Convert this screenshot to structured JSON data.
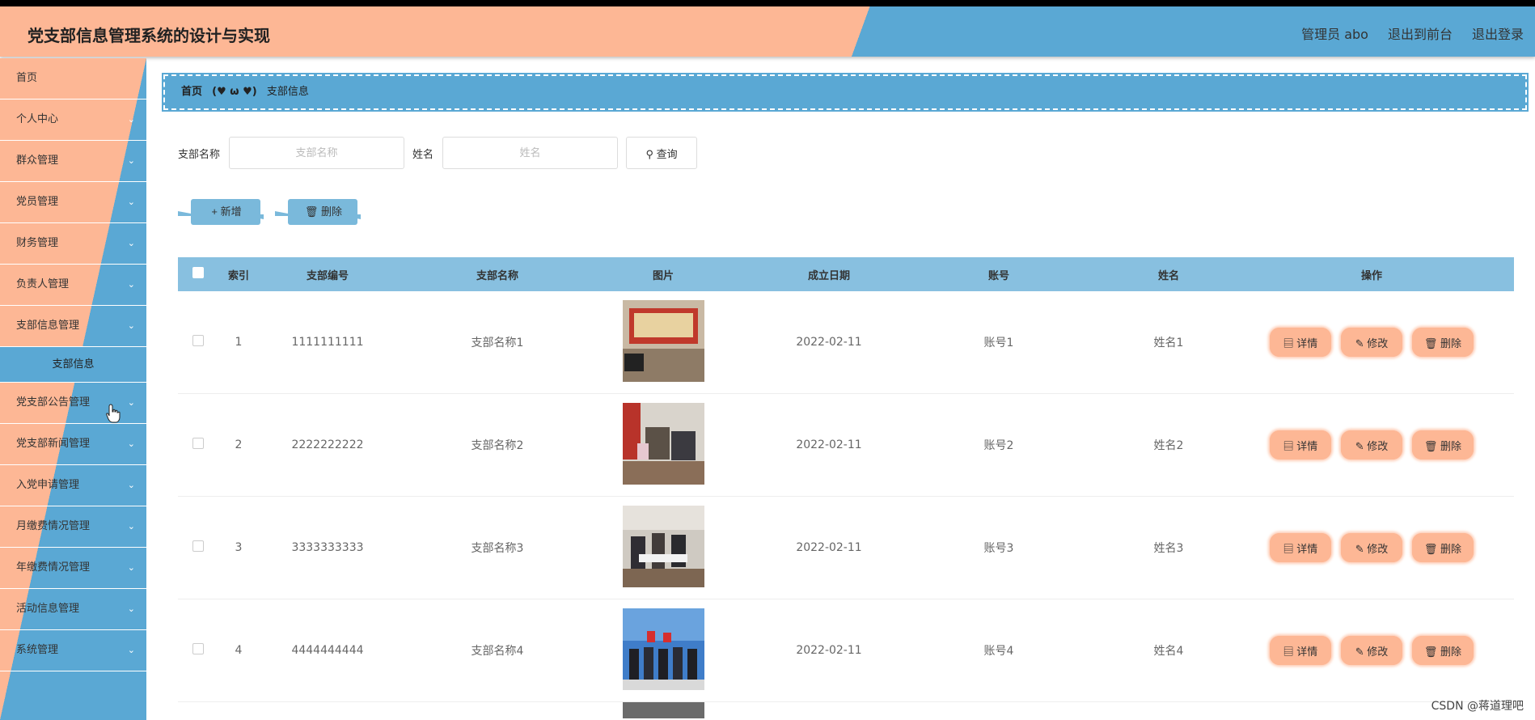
{
  "app": {
    "title": "党支部信息管理系统的设计与实现",
    "user_label": "管理员 abo",
    "front_link": "退出到前台",
    "logout_link": "退出登录"
  },
  "sidebar": {
    "items": [
      {
        "label": "首页",
        "has_chevron": false
      },
      {
        "label": "个人中心",
        "has_chevron": true
      },
      {
        "label": "群众管理",
        "has_chevron": true
      },
      {
        "label": "党员管理",
        "has_chevron": true
      },
      {
        "label": "财务管理",
        "has_chevron": true
      },
      {
        "label": "负责人管理",
        "has_chevron": true
      },
      {
        "label": "支部信息管理",
        "has_chevron": true
      },
      {
        "label": "党支部公告管理",
        "has_chevron": true
      },
      {
        "label": "党支部新闻管理",
        "has_chevron": true
      },
      {
        "label": "入党申请管理",
        "has_chevron": true
      },
      {
        "label": "月缴费情况管理",
        "has_chevron": true
      },
      {
        "label": "年缴费情况管理",
        "has_chevron": true
      },
      {
        "label": "活动信息管理",
        "has_chevron": true
      },
      {
        "label": "系统管理",
        "has_chevron": true
      }
    ],
    "active_sub": "支部信息"
  },
  "breadcrumb": {
    "home": "首页",
    "separator": "(♥ ω ♥)",
    "current": "支部信息"
  },
  "search": {
    "branch_label": "支部名称",
    "branch_placeholder": "支部名称",
    "name_label": "姓名",
    "name_placeholder": "姓名",
    "query_button": "查询"
  },
  "toolbar": {
    "add_label": "新增",
    "delete_label": "删除"
  },
  "table": {
    "headers": [
      "索引",
      "支部编号",
      "支部名称",
      "图片",
      "成立日期",
      "账号",
      "姓名",
      "操作"
    ],
    "rows": [
      {
        "index": "1",
        "number": "1111111111",
        "name": "支部名称1",
        "date": "2022-02-11",
        "account": "账号1",
        "user": "姓名1"
      },
      {
        "index": "2",
        "number": "2222222222",
        "name": "支部名称2",
        "date": "2022-02-11",
        "account": "账号2",
        "user": "姓名2"
      },
      {
        "index": "3",
        "number": "3333333333",
        "name": "支部名称3",
        "date": "2022-02-11",
        "account": "账号3",
        "user": "姓名3"
      },
      {
        "index": "4",
        "number": "4444444444",
        "name": "支部名称4",
        "date": "2022-02-11",
        "account": "账号4",
        "user": "姓名4"
      }
    ],
    "ops": {
      "detail": "详情",
      "edit": "修改",
      "delete": "删除"
    }
  },
  "watermark": "CSDN @蒋道理吧",
  "colors": {
    "peach": "#fdb795",
    "blue": "#5aa8d4",
    "header_row": "#88c0e0"
  }
}
